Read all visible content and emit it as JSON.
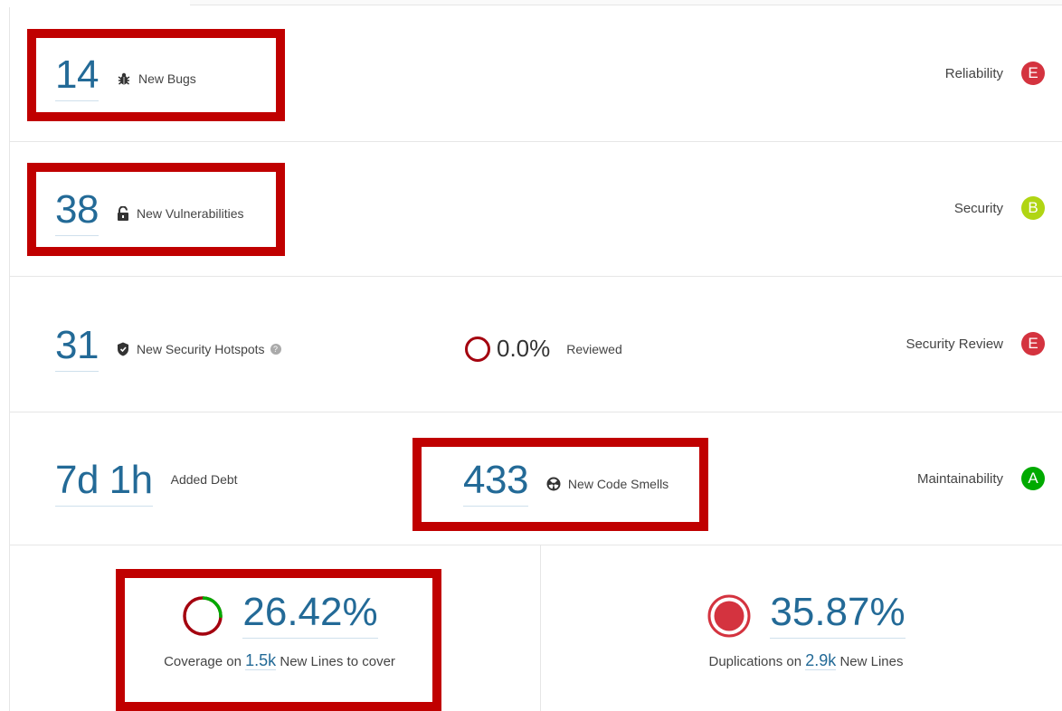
{
  "colors": {
    "link": "#236a97",
    "rating_E": "#d4333f",
    "rating_B": "#b0d513",
    "rating_A": "#00aa00",
    "highlight": "#c00000"
  },
  "rows": {
    "bugs": {
      "value": "14",
      "label": "New Bugs",
      "icon": "bug-icon",
      "rating_label": "Reliability",
      "rating": "E"
    },
    "vulnerabilities": {
      "value": "38",
      "label": "New Vulnerabilities",
      "icon": "lock-icon",
      "rating_label": "Security",
      "rating": "B"
    },
    "hotspots": {
      "value": "31",
      "label": "New Security Hotspots",
      "icon": "shield-icon",
      "help_icon": "help-icon",
      "reviewed_value": "0.0%",
      "reviewed_label": "Reviewed",
      "rating_label": "Security Review",
      "rating": "E"
    },
    "debt": {
      "value": "7d 1h",
      "label": "Added Debt",
      "smells_value": "433",
      "smells_label": "New Code Smells",
      "smells_icon": "code-smell-icon",
      "rating_label": "Maintainability",
      "rating": "A"
    }
  },
  "coverage": {
    "value": "26.42%",
    "percent": 26.42,
    "label_prefix": "Coverage on",
    "lines": "1.5k",
    "label_suffix": "New Lines to cover"
  },
  "duplications": {
    "value": "35.87%",
    "label_prefix": "Duplications on",
    "lines": "2.9k",
    "label_suffix": "New Lines"
  }
}
